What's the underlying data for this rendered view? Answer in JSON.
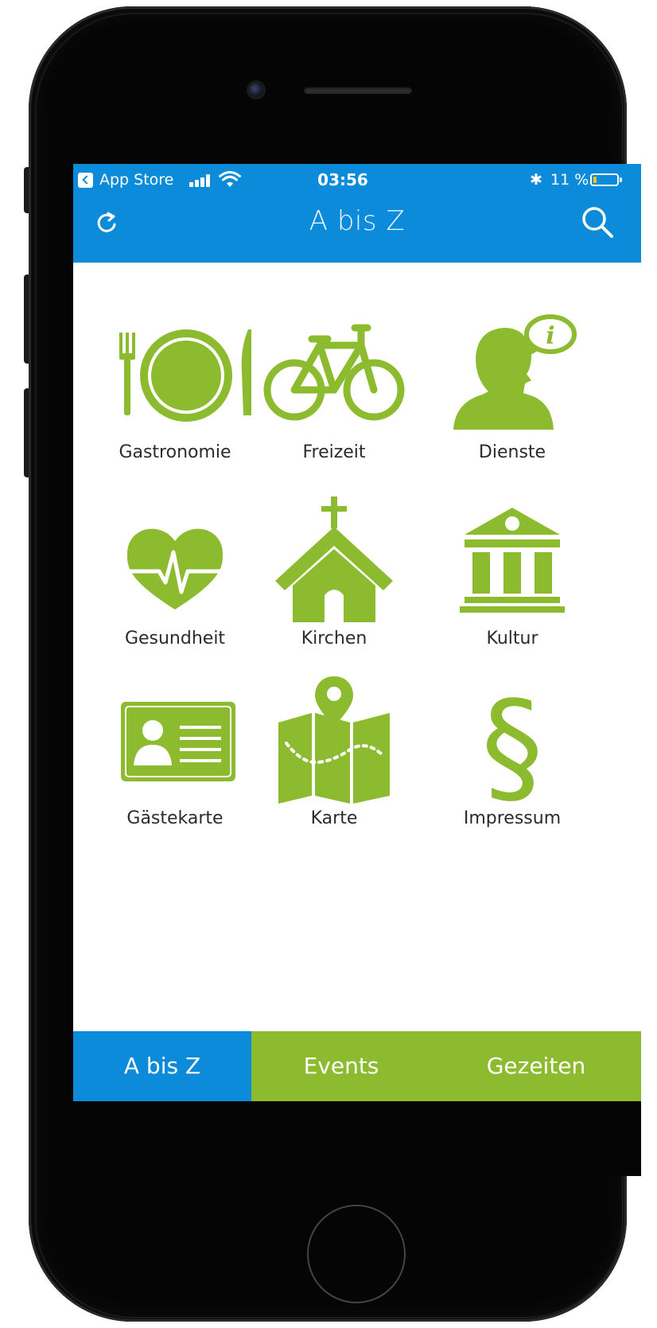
{
  "status_bar": {
    "carrier": "App Store",
    "time": "03:56",
    "bluetooth": "✱",
    "battery_percent": "11 %"
  },
  "header": {
    "title": "A bis Z",
    "refresh_icon": "refresh-icon",
    "search_icon": "search-icon"
  },
  "tiles": [
    {
      "label": "Gastronomie",
      "icon": "dining-icon"
    },
    {
      "label": "Freizeit",
      "icon": "bicycle-icon"
    },
    {
      "label": "Dienste",
      "icon": "info-person-icon"
    },
    {
      "label": "Gesundheit",
      "icon": "heart-pulse-icon"
    },
    {
      "label": "Kirchen",
      "icon": "church-icon"
    },
    {
      "label": "Kultur",
      "icon": "museum-icon"
    },
    {
      "label": "Gästekarte",
      "icon": "id-card-icon"
    },
    {
      "label": "Karte",
      "icon": "map-icon"
    },
    {
      "label": "Impressum",
      "icon": "paragraph-icon"
    }
  ],
  "tabs": [
    {
      "label": "A bis Z",
      "active": true
    },
    {
      "label": "Events",
      "active": false
    },
    {
      "label": "Gezeiten",
      "active": false
    }
  ],
  "colors": {
    "header_blue": "#0b8bd9",
    "icon_green": "#8dbb2f",
    "tab_green": "#8dbb2f",
    "battery_low": "#f5c518"
  }
}
